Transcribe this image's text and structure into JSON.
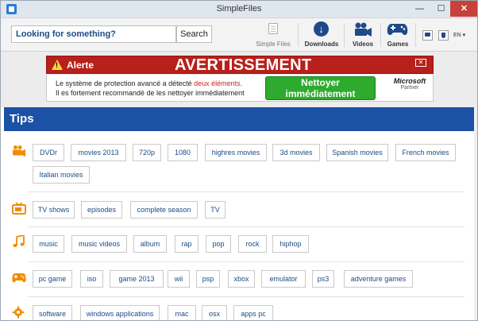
{
  "window": {
    "title": "SimpleFiles",
    "min": "—",
    "max": "☐",
    "close": "✕"
  },
  "search": {
    "value": "Looking for something?",
    "button": "Search"
  },
  "toolbar": {
    "simple_files": "Simple Files",
    "downloads": "Downloads",
    "videos": "Videos",
    "games": "Games",
    "lang": "EN ▾"
  },
  "ad": {
    "alert": "Alerte",
    "title": "AVERTISSEMENT",
    "close": "✕",
    "line1_a": "Le système de protection avancé  a détecté ",
    "line1_b": "deux éléments.",
    "line2": "Il es fortement recommandé de les nettoyer immédiatement",
    "cta": "Nettoyer immédiatement",
    "brand": "Microsoft",
    "brand_sub": "Partner"
  },
  "tips": {
    "title": "Tips",
    "movies": [
      "DVDr",
      "movies 2013",
      "720p",
      "1080",
      "highres movies",
      "3d movies",
      "Spanish movies",
      "French movies",
      "Italian movies"
    ],
    "tv": [
      "TV shows",
      "episodes",
      "complete season",
      "TV"
    ],
    "music": [
      "music",
      "music videos",
      "album",
      "rap",
      "pop",
      "rock",
      "hiphop"
    ],
    "games": [
      "pc game",
      "iso",
      "game 2013",
      "wii",
      "psp",
      "xbox",
      "emulator",
      "ps3",
      "adventure games"
    ],
    "software": [
      "software",
      "windows applications",
      "mac",
      "osx",
      "apps pc"
    ]
  },
  "colors": {
    "accent": "#1b52a6",
    "icon": "#f08c00",
    "alert": "#b8201b",
    "cta": "#2eaa2e",
    "tag_text": "#1c4b86"
  }
}
